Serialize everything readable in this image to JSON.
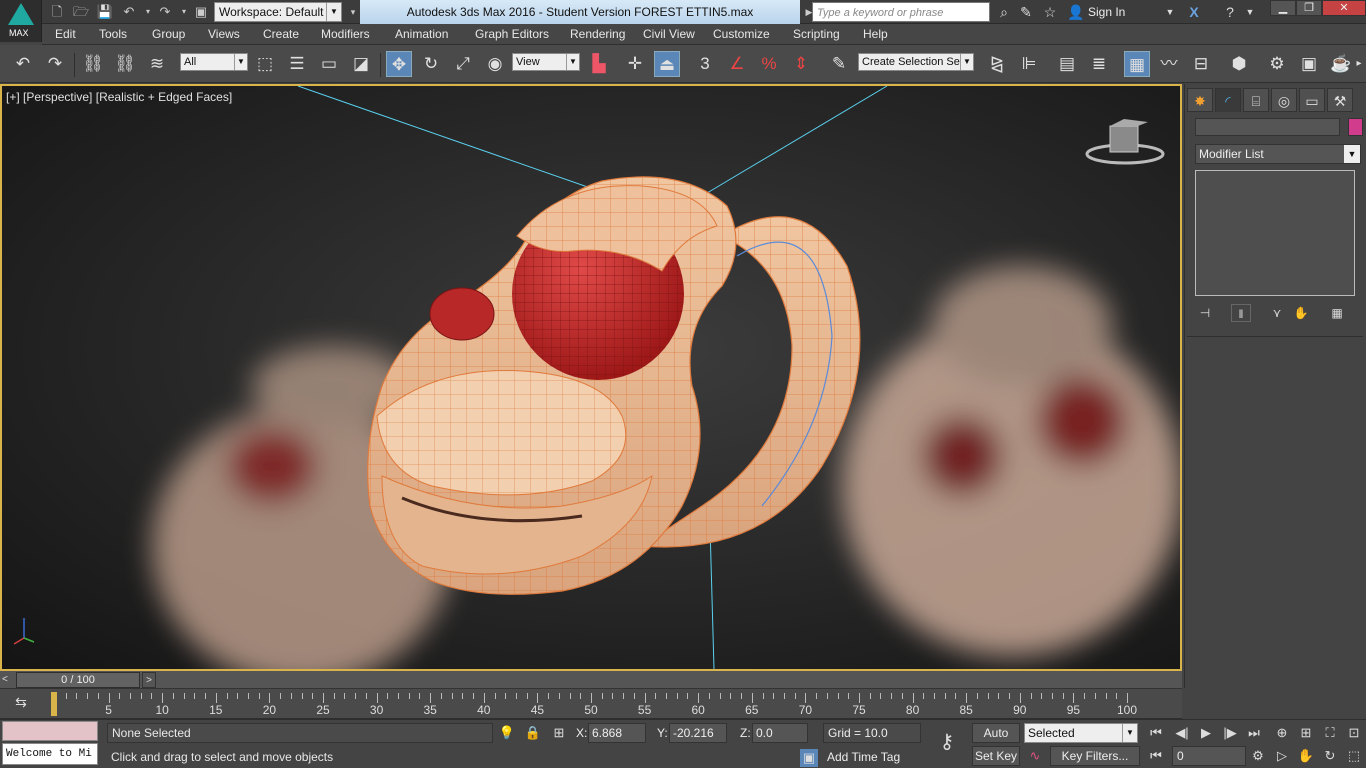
{
  "titlebar": {
    "workspace": "Workspace: Default",
    "app_title": "Autodesk 3ds Max 2016 - Student Version     FOREST ETTIN5.max",
    "search_placeholder": "Type a keyword or phrase",
    "sign_in": "Sign In",
    "logo_text": "MAX"
  },
  "menu": [
    "Edit",
    "Tools",
    "Group",
    "Views",
    "Create",
    "Modifiers",
    "Animation",
    "Graph Editors",
    "Rendering",
    "Civil View",
    "Customize",
    "Scripting",
    "Help"
  ],
  "toolbar": {
    "selection_filter": "All",
    "reference_coord": "View",
    "named_selection": "Create Selection Se",
    "snap_label": "3"
  },
  "viewport": {
    "label_plus": "[+]",
    "label_view": "[Perspective]",
    "label_shading": "[Realistic + Edged Faces]",
    "colors": {
      "border": "#d8b44a",
      "skin": "#e7b58d",
      "eye": "#c0282a",
      "wire": "#e07a3c"
    }
  },
  "command_panel": {
    "modifier_list": "Modifier List",
    "object_color": "#d23c8c"
  },
  "timeline": {
    "position": "0 / 100",
    "ticks": [
      "0",
      "5",
      "10",
      "15",
      "20",
      "25",
      "30",
      "35",
      "40",
      "45",
      "50",
      "55",
      "60",
      "65",
      "70",
      "75",
      "80",
      "85",
      "90",
      "95",
      "100"
    ]
  },
  "status": {
    "selection": "None Selected",
    "prompt": "Click and drag to select and move objects",
    "script_listener": "Welcome to Mi",
    "x_label": "X:",
    "x_value": "6.868",
    "y_label": "Y:",
    "y_value": "-20.216",
    "z_label": "Z:",
    "z_value": "0.0",
    "grid": "Grid = 10.0",
    "add_time_tag": "Add Time Tag",
    "auto_key": "Auto Key",
    "set_key": "Set Key",
    "key_mode": "Selected",
    "key_filters": "Key Filters...",
    "current_frame": "0"
  }
}
